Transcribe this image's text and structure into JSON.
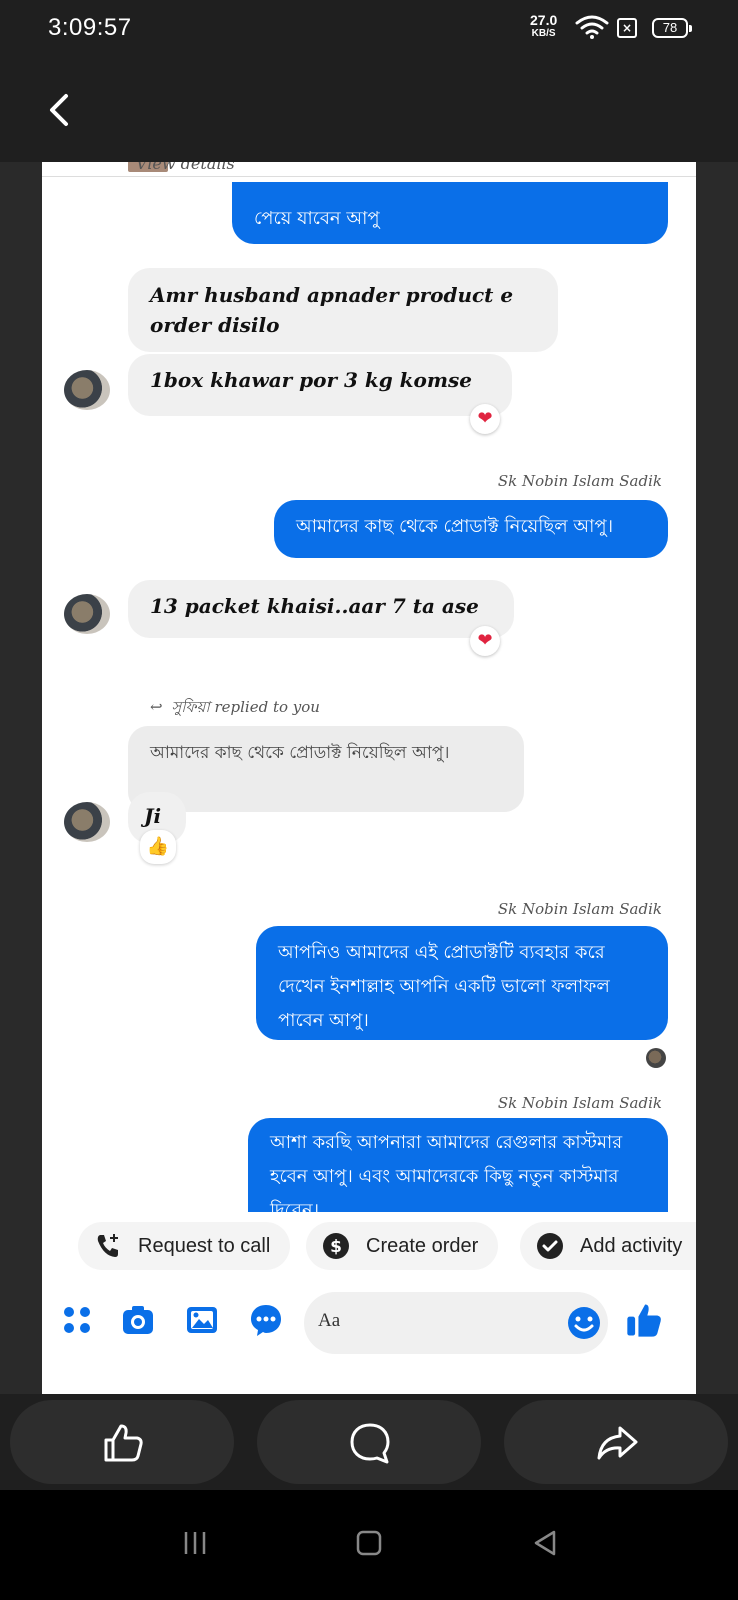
{
  "status_bar": {
    "time": "3:09:57",
    "net_speed_value": "27.0",
    "net_speed_unit": "KB/S",
    "battery": "78"
  },
  "chat": {
    "cut_header_text": "View details",
    "messages": [
      {
        "type": "outgoing",
        "text": "পেয়ে যাবেন আপু"
      },
      {
        "type": "incoming",
        "text": "Amr husband apnader product e order disilo"
      },
      {
        "type": "incoming",
        "text": "1box khawar por 3 kg komse",
        "reaction": "❤"
      },
      {
        "type": "sender_label",
        "text": "Sk Nobin Islam Sadik"
      },
      {
        "type": "outgoing",
        "text": "আমাদের কাছ থেকে প্রোডাক্ট নিয়েছিল আপু।"
      },
      {
        "type": "incoming",
        "text": "13 packet khaisi..aar 7 ta ase",
        "reaction": "❤"
      },
      {
        "type": "reply_note",
        "text": "সুফিয়া replied to you"
      },
      {
        "type": "quoted",
        "text": "আমাদের কাছ থেকে প্রোডাক্ট নিয়েছিল আপু।"
      },
      {
        "type": "incoming",
        "text": "Ji",
        "reaction": "👍"
      },
      {
        "type": "sender_label",
        "text": "Sk Nobin Islam Sadik"
      },
      {
        "type": "outgoing",
        "text": "আপনিও আমাদের এই প্রোডাক্টটি ব্যবহার করে দেখেন ইনশাল্লাহ আপনি একটি ভালো ফলাফল পাবেন আপু।"
      },
      {
        "type": "sender_label",
        "text": "Sk Nobin Islam Sadik"
      },
      {
        "type": "outgoing",
        "text": "আশা করছি আপনারা আমাদের রেগুলার কাস্টমার হবেন আপু। এবং আমাদেরকে কিছু নতুন কাস্টমার দিবেন।"
      }
    ]
  },
  "chips": {
    "request_call": "Request to call",
    "create_order": "Create order",
    "add_activity": "Add activity"
  },
  "composer": {
    "placeholder": "Aa"
  },
  "colors": {
    "messenger_blue": "#0a6fe8",
    "incoming_bubble": "#f0f0f0",
    "reaction_heart": "#e0233f",
    "dark_chrome": "#1f1f1f"
  },
  "icons": [
    "back-arrow-icon",
    "wifi-icon",
    "like-icon",
    "comment-icon",
    "share-icon",
    "phone-plus-icon",
    "dollar-icon",
    "check-icon",
    "menu-dots-icon",
    "camera-icon",
    "image-icon",
    "chat-bubble-icon",
    "emoji-icon",
    "thumbs-up-icon"
  ]
}
